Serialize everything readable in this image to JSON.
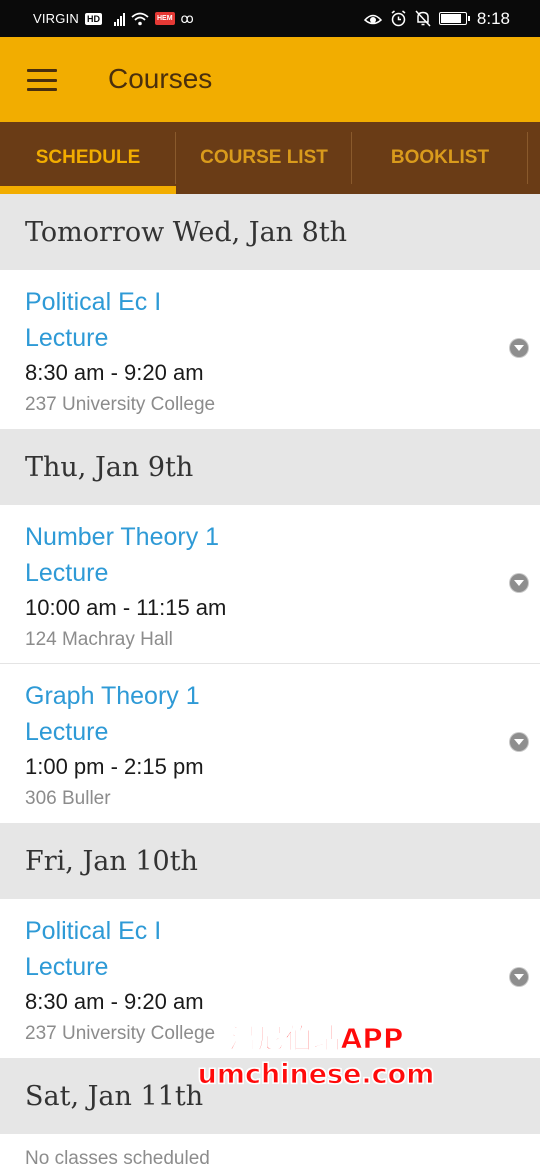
{
  "status_bar": {
    "carrier": "VIRGIN",
    "hd_badge": "HD",
    "notification_badge": "HEM",
    "voicemail_glyph": "ꝏ",
    "icons": [
      "eye-icon",
      "alarm-icon",
      "mute-icon",
      "battery-icon"
    ],
    "battery_level": 0.85,
    "time": "8:18"
  },
  "app_bar": {
    "menu_icon": "hamburger-menu-icon",
    "title": "Courses",
    "color": "#f2ad00"
  },
  "tabs": [
    {
      "label": "SCHEDULE",
      "active": true
    },
    {
      "label": "COURSE LIST",
      "active": false
    },
    {
      "label": "BOOKLIST",
      "active": false
    }
  ],
  "schedule": [
    {
      "day": "Tomorrow  Wed, Jan 8th",
      "courses": [
        {
          "name": "Political Ec I",
          "type": "Lecture",
          "time": "8:30 am - 9:20 am",
          "location": "237 University College"
        }
      ]
    },
    {
      "day": "Thu, Jan 9th",
      "courses": [
        {
          "name": "Number Theory 1",
          "type": "Lecture",
          "time": "10:00 am - 11:15 am",
          "location": "124 Machray Hall"
        },
        {
          "name": "Graph Theory 1",
          "type": "Lecture",
          "time": "1:00 pm - 2:15 pm",
          "location": "306 Buller"
        }
      ]
    },
    {
      "day": "Fri, Jan 10th",
      "courses": [
        {
          "name": "Political Ec I",
          "type": "Lecture",
          "time": "8:30 am - 9:20 am",
          "location": "237 University College"
        }
      ]
    },
    {
      "day": "Sat, Jan 11th",
      "empty_text": "No classes scheduled"
    }
  ],
  "watermark": {
    "line1": "温尼伯站APP",
    "line2": "umchinese.com"
  },
  "colors": {
    "accent": "#f2ad00",
    "tab_bar": "#6a3c16",
    "course_link": "#2e9ad6",
    "day_header_bg": "#e6e6e6"
  }
}
